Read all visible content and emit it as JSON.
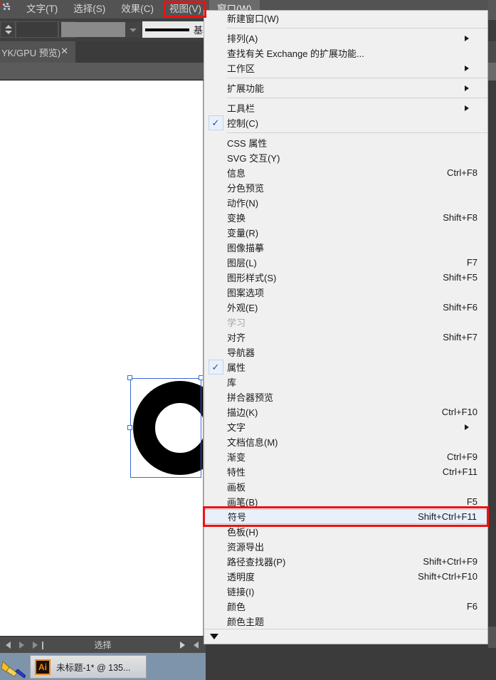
{
  "app": {
    "name": "Adobe Illustrator",
    "menubar": {
      "items": [
        {
          "label": "文字(T)",
          "highlighted": false
        },
        {
          "label": "选择(S)",
          "highlighted": false
        },
        {
          "label": "效果(C)",
          "highlighted": false
        },
        {
          "label": "视图(V)",
          "highlighted": false
        },
        {
          "label": "窗口(W)",
          "highlighted": true
        }
      ]
    },
    "controlbar": {
      "stroke_label": "基本",
      "combo_value": "",
      "wide_value": ""
    },
    "document_tab": {
      "title": "YK/GPU 预览)",
      "close": "✕"
    },
    "statusbar": {
      "status_text": "选择"
    },
    "taskbar": {
      "app_badge": "Ai",
      "window_title": "未标题-1* @ 135..."
    }
  },
  "menu": {
    "title": "窗口(W)",
    "groups": [
      {
        "items": [
          {
            "label": "新建窗口(W)",
            "accel": "",
            "submenu": false,
            "checked": false,
            "disabled": false,
            "selected": false
          }
        ]
      },
      {
        "items": [
          {
            "label": "排列(A)",
            "accel": "",
            "submenu": true,
            "checked": false,
            "disabled": false,
            "selected": false
          },
          {
            "label": "查找有关 Exchange 的扩展功能...",
            "accel": "",
            "submenu": false,
            "checked": false,
            "disabled": false,
            "selected": false
          },
          {
            "label": "工作区",
            "accel": "",
            "submenu": true,
            "checked": false,
            "disabled": false,
            "selected": false
          }
        ]
      },
      {
        "items": [
          {
            "label": "扩展功能",
            "accel": "",
            "submenu": true,
            "checked": false,
            "disabled": false,
            "selected": false
          }
        ]
      },
      {
        "items": [
          {
            "label": "工具栏",
            "accel": "",
            "submenu": true,
            "checked": false,
            "disabled": false,
            "selected": false
          },
          {
            "label": "控制(C)",
            "accel": "",
            "submenu": false,
            "checked": true,
            "disabled": false,
            "selected": false
          }
        ]
      },
      {
        "items": [
          {
            "label": "CSS 属性",
            "accel": "",
            "submenu": false,
            "checked": false,
            "disabled": false,
            "selected": false
          },
          {
            "label": "SVG 交互(Y)",
            "accel": "",
            "submenu": false,
            "checked": false,
            "disabled": false,
            "selected": false
          },
          {
            "label": "信息",
            "accel": "Ctrl+F8",
            "submenu": false,
            "checked": false,
            "disabled": false,
            "selected": false
          },
          {
            "label": "分色预览",
            "accel": "",
            "submenu": false,
            "checked": false,
            "disabled": false,
            "selected": false
          },
          {
            "label": "动作(N)",
            "accel": "",
            "submenu": false,
            "checked": false,
            "disabled": false,
            "selected": false
          },
          {
            "label": "变换",
            "accel": "Shift+F8",
            "submenu": false,
            "checked": false,
            "disabled": false,
            "selected": false
          },
          {
            "label": "变量(R)",
            "accel": "",
            "submenu": false,
            "checked": false,
            "disabled": false,
            "selected": false
          },
          {
            "label": "图像描摹",
            "accel": "",
            "submenu": false,
            "checked": false,
            "disabled": false,
            "selected": false
          },
          {
            "label": "图层(L)",
            "accel": "F7",
            "submenu": false,
            "checked": false,
            "disabled": false,
            "selected": false
          },
          {
            "label": "图形样式(S)",
            "accel": "Shift+F5",
            "submenu": false,
            "checked": false,
            "disabled": false,
            "selected": false
          },
          {
            "label": "图案选项",
            "accel": "",
            "submenu": false,
            "checked": false,
            "disabled": false,
            "selected": false
          },
          {
            "label": "外观(E)",
            "accel": "Shift+F6",
            "submenu": false,
            "checked": false,
            "disabled": false,
            "selected": false
          },
          {
            "label": "学习",
            "accel": "",
            "submenu": false,
            "checked": false,
            "disabled": true,
            "selected": false
          },
          {
            "label": "对齐",
            "accel": "Shift+F7",
            "submenu": false,
            "checked": false,
            "disabled": false,
            "selected": false
          },
          {
            "label": "导航器",
            "accel": "",
            "submenu": false,
            "checked": false,
            "disabled": false,
            "selected": false
          },
          {
            "label": "属性",
            "accel": "",
            "submenu": false,
            "checked": true,
            "disabled": false,
            "selected": false
          },
          {
            "label": "库",
            "accel": "",
            "submenu": false,
            "checked": false,
            "disabled": false,
            "selected": false
          },
          {
            "label": "拼合器预览",
            "accel": "",
            "submenu": false,
            "checked": false,
            "disabled": false,
            "selected": false
          },
          {
            "label": "描边(K)",
            "accel": "Ctrl+F10",
            "submenu": false,
            "checked": false,
            "disabled": false,
            "selected": false
          },
          {
            "label": "文字",
            "accel": "",
            "submenu": true,
            "checked": false,
            "disabled": false,
            "selected": false
          },
          {
            "label": "文档信息(M)",
            "accel": "",
            "submenu": false,
            "checked": false,
            "disabled": false,
            "selected": false
          },
          {
            "label": "渐变",
            "accel": "Ctrl+F9",
            "submenu": false,
            "checked": false,
            "disabled": false,
            "selected": false
          },
          {
            "label": "特性",
            "accel": "Ctrl+F11",
            "submenu": false,
            "checked": false,
            "disabled": false,
            "selected": false
          },
          {
            "label": "画板",
            "accel": "",
            "submenu": false,
            "checked": false,
            "disabled": false,
            "selected": false
          },
          {
            "label": "画笔(B)",
            "accel": "F5",
            "submenu": false,
            "checked": false,
            "disabled": false,
            "selected": false
          },
          {
            "label": "符号",
            "accel": "Shift+Ctrl+F11",
            "submenu": false,
            "checked": false,
            "disabled": false,
            "selected": true
          },
          {
            "label": "色板(H)",
            "accel": "",
            "submenu": false,
            "checked": false,
            "disabled": false,
            "selected": false
          },
          {
            "label": "资源导出",
            "accel": "",
            "submenu": false,
            "checked": false,
            "disabled": false,
            "selected": false
          },
          {
            "label": "路径查找器(P)",
            "accel": "Shift+Ctrl+F9",
            "submenu": false,
            "checked": false,
            "disabled": false,
            "selected": false
          },
          {
            "label": "透明度",
            "accel": "Shift+Ctrl+F10",
            "submenu": false,
            "checked": false,
            "disabled": false,
            "selected": false
          },
          {
            "label": "链接(I)",
            "accel": "",
            "submenu": false,
            "checked": false,
            "disabled": false,
            "selected": false
          },
          {
            "label": "颜色",
            "accel": "F6",
            "submenu": false,
            "checked": false,
            "disabled": false,
            "selected": false
          },
          {
            "label": "颜色主题",
            "accel": "",
            "submenu": false,
            "checked": false,
            "disabled": false,
            "selected": false
          }
        ]
      }
    ],
    "scroll_down_glyph": "▼"
  },
  "annotations": {
    "accent_color": "#ee1111",
    "boxes": [
      "窗口(W)",
      "符号"
    ]
  },
  "artwork": {
    "shape": "letter-c-glyph",
    "fill_color": "#000000",
    "selection_color": "#3b6bd6"
  }
}
